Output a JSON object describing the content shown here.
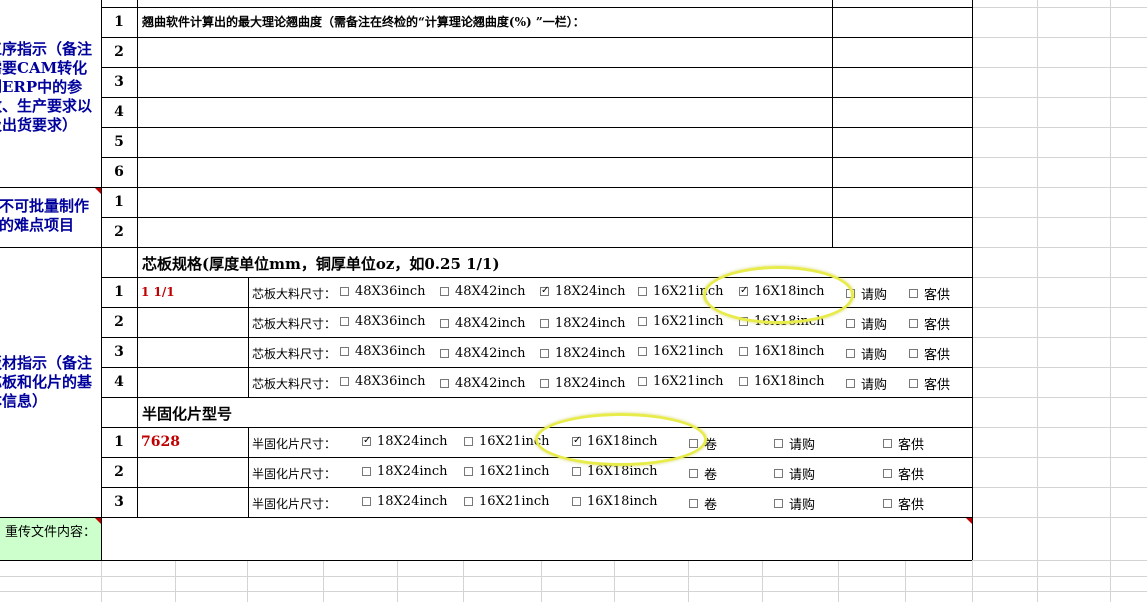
{
  "sections": {
    "process": "工序指示（备注需要CAM转化到ERP中的参数、生产要求以及出货要求）",
    "difficult": "不可批量制作的难点项目",
    "material": "板材指示（备注芯板和化片的基本信息）",
    "reupload": "重传文件内容："
  },
  "process_rows": {
    "nums": [
      "1",
      "2",
      "3",
      "4",
      "5",
      "6"
    ],
    "row1_text": "翘曲软件计算出的最大理论翘曲度（需备注在终检的“计算理论翘曲度(%) ”一栏）："
  },
  "difficult_rows": {
    "nums": [
      "1",
      "2"
    ]
  },
  "core": {
    "header": "芯板规格(厚度单位mm，铜厚单位oz，如0.25 1/1)",
    "row_label": "芯板大料尺寸：",
    "options": [
      "48X36inch",
      "48X42inch",
      "18X24inch",
      "16X21inch",
      "16X18inch",
      "请购",
      "客供"
    ],
    "rows": [
      {
        "num": "1",
        "spec": "1 1/1",
        "checked": [
          false,
          false,
          true,
          false,
          true,
          false,
          false
        ]
      },
      {
        "num": "2",
        "spec": "",
        "checked": [
          false,
          false,
          false,
          false,
          false,
          false,
          false
        ]
      },
      {
        "num": "3",
        "spec": "",
        "checked": [
          false,
          false,
          false,
          false,
          false,
          false,
          false
        ]
      },
      {
        "num": "4",
        "spec": "",
        "checked": [
          false,
          false,
          false,
          false,
          false,
          false,
          false
        ]
      }
    ]
  },
  "prepreg": {
    "header": "半固化片型号",
    "row_label": "半固化片尺寸：",
    "options": [
      "18X24inch",
      "16X21inch",
      "16X18inch",
      "卷",
      "请购",
      "客供"
    ],
    "rows": [
      {
        "num": "1",
        "spec": "7628",
        "checked": [
          true,
          false,
          true,
          false,
          false,
          false
        ]
      },
      {
        "num": "2",
        "spec": "",
        "checked": [
          false,
          false,
          false,
          false,
          false,
          false
        ]
      },
      {
        "num": "3",
        "spec": "",
        "checked": [
          false,
          false,
          false,
          false,
          false,
          false
        ]
      }
    ]
  },
  "colors": {
    "section_text": "#00009c",
    "red_text": "#c00000",
    "highlight": "#e8ec4a",
    "reupload_bg": "#ccffcc"
  }
}
